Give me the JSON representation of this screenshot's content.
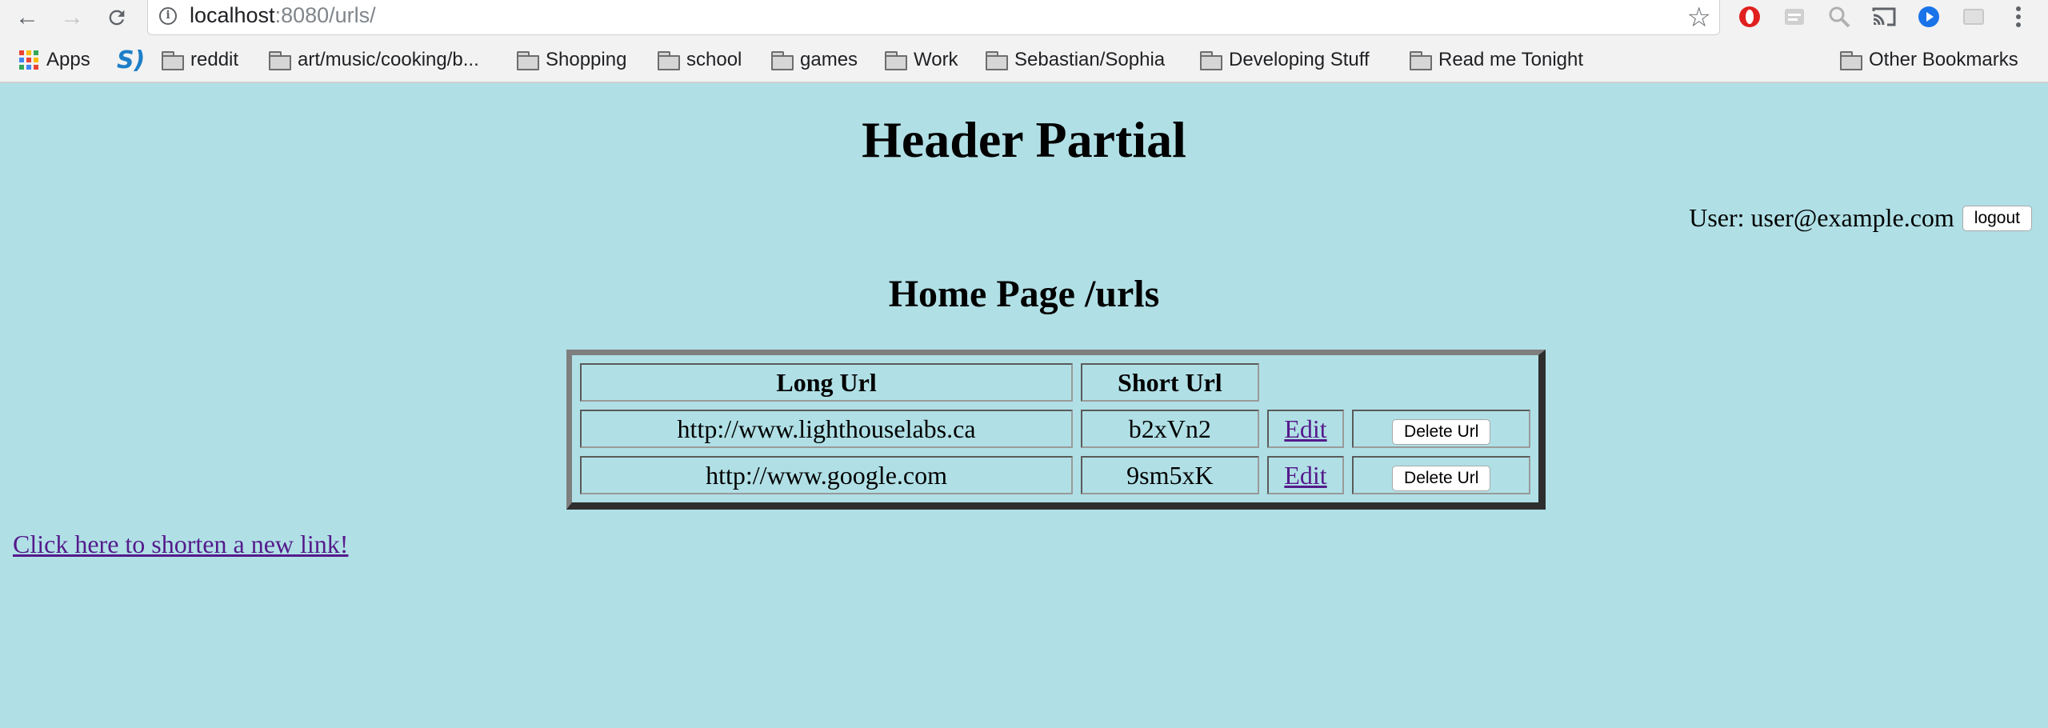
{
  "browser": {
    "url_host": "localhost",
    "url_path": ":8080/urls/",
    "bookmarks": [
      {
        "label": "Apps",
        "icon": "apps-icon"
      },
      {
        "label": "",
        "icon": "sitepoint-s-icon"
      },
      {
        "label": "reddit",
        "icon": "folder-icon"
      },
      {
        "label": "art/music/cooking/b...",
        "icon": "folder-icon"
      },
      {
        "label": "Shopping",
        "icon": "folder-icon"
      },
      {
        "label": "school",
        "icon": "folder-icon"
      },
      {
        "label": "games",
        "icon": "folder-icon"
      },
      {
        "label": "Work",
        "icon": "folder-icon"
      },
      {
        "label": "Sebastian/Sophia",
        "icon": "folder-icon"
      },
      {
        "label": "Developing Stuff",
        "icon": "folder-icon"
      },
      {
        "label": "Read me Tonight",
        "icon": "folder-icon"
      }
    ],
    "other_bookmarks": "Other Bookmarks"
  },
  "page": {
    "header": "Header Partial",
    "user_label": "User: user@example.com",
    "logout_label": "logout",
    "title": "Home Page /urls",
    "table": {
      "headers": [
        "Long Url",
        "Short Url"
      ],
      "rows": [
        {
          "long_url": "http://www.lighthouselabs.ca",
          "short_url": "b2xVn2",
          "edit": "Edit",
          "delete": "Delete Url"
        },
        {
          "long_url": "http://www.google.com",
          "short_url": "9sm5xK",
          "edit": "Edit",
          "delete": "Delete Url"
        }
      ]
    },
    "new_link": "Click here to shorten a new link!"
  },
  "colors": {
    "page_background": "#b0e0e6",
    "link": "#551a8b"
  }
}
